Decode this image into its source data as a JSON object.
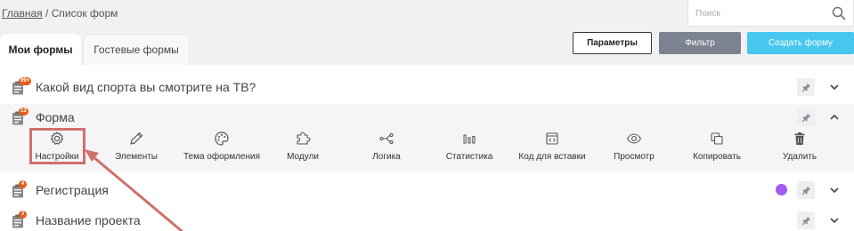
{
  "breadcrumb": {
    "home": "Главная",
    "separator": " / ",
    "current": "Список форм"
  },
  "search": {
    "placeholder": "Поиск",
    "value": ""
  },
  "tabs": [
    {
      "label": "Мои формы",
      "active": true
    },
    {
      "label": "Гостевые формы",
      "active": false
    }
  ],
  "actions": {
    "params_label": "Параметры",
    "filter_label": "Фильтр",
    "create_label": "Создать форму"
  },
  "forms": [
    {
      "title": "Какой вид спорта вы смотрите на ТВ?",
      "badge": "99+",
      "expanded": false
    },
    {
      "title": "Форма",
      "badge": "13",
      "expanded": true
    },
    {
      "title": "Регистрация",
      "badge": "4",
      "expanded": false,
      "dot_color": "#a35bf0"
    },
    {
      "title": "Название проекта",
      "badge": "3",
      "expanded": false
    }
  ],
  "toolbar": [
    {
      "label": "Настройки",
      "icon": "gear-icon"
    },
    {
      "label": "Элементы",
      "icon": "pencil-icon"
    },
    {
      "label": "Тема оформления",
      "icon": "palette-icon"
    },
    {
      "label": "Модули",
      "icon": "puzzle-icon"
    },
    {
      "label": "Логика",
      "icon": "logic-icon"
    },
    {
      "label": "Статистика",
      "icon": "bar-chart-icon"
    },
    {
      "label": "Код для вставки",
      "icon": "code-icon"
    },
    {
      "label": "Просмотр",
      "icon": "eye-icon"
    },
    {
      "label": "Копировать",
      "icon": "copy-icon"
    },
    {
      "label": "Удалить",
      "icon": "trash-icon"
    }
  ],
  "colors": {
    "accent": "#47c6f0",
    "filter_button": "#7c8290",
    "badge": "#e35d1a",
    "highlight": "#d0706d"
  }
}
